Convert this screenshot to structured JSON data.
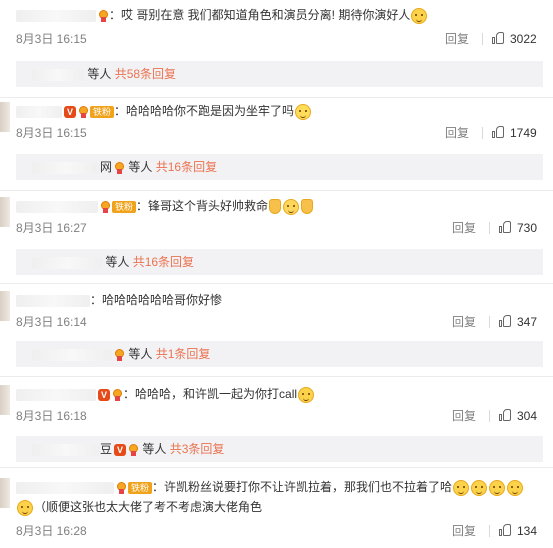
{
  "colors": {
    "accent": "#eb7350",
    "meta": "#808080",
    "fan_badge": "#f0a21a",
    "reply_bg": "#f2f2f5"
  },
  "actions": {
    "reply": "回复"
  },
  "comments": [
    {
      "text": "哎 哥别在意 我们都知道角色和演员分离! 期待你演好人",
      "emojis": [
        "doge-icon"
      ],
      "time": "8月3日 16:15",
      "likes": "3022",
      "reply_summary": {
        "name_suffix": "",
        "people": "等人",
        "count": "共58条回复"
      }
    },
    {
      "fan_label": "铁粉",
      "text": "哈哈哈哈你不跑是因为坐牢了吗",
      "emojis": [
        "smirk-icon"
      ],
      "time": "8月3日 16:15",
      "likes": "1749",
      "reply_summary": {
        "name_suffix": "网",
        "people": "等人",
        "count": "共16条回复"
      }
    },
    {
      "fan_label": "铁粉",
      "text": "锋哥这个背头好帅救命",
      "emojis": [
        "thumbs-up-icon",
        "crying-icon",
        "thumbs-up-icon"
      ],
      "time": "8月3日 16:27",
      "likes": "730",
      "reply_summary": {
        "name_suffix": "",
        "people": "等人",
        "count": "共16条回复"
      }
    },
    {
      "text": "哈哈哈哈哈哈哥你好惨",
      "emojis": [],
      "time": "8月3日 16:14",
      "likes": "347",
      "reply_summary": {
        "name_suffix": "",
        "people": "等人",
        "count": "共1条回复"
      }
    },
    {
      "text": "哈哈哈，和许凯一起为你打call",
      "emojis": [
        "doge-icon"
      ],
      "time": "8月3日 16:18",
      "likes": "304",
      "reply_summary": {
        "name_suffix": "豆",
        "people": "等人",
        "count": "共3条回复"
      }
    },
    {
      "fan_label": "铁粉",
      "text": "许凯粉丝说要打你不让许凯拉着，那我们也不拉着了哈",
      "text2": "（顺便这张也太大佬了考不考虑演大佬角色",
      "emojis": [
        "doge-icon",
        "doge-icon",
        "doge-icon",
        "doge-icon"
      ],
      "time": "8月3日 16:28",
      "likes": "134"
    }
  ]
}
